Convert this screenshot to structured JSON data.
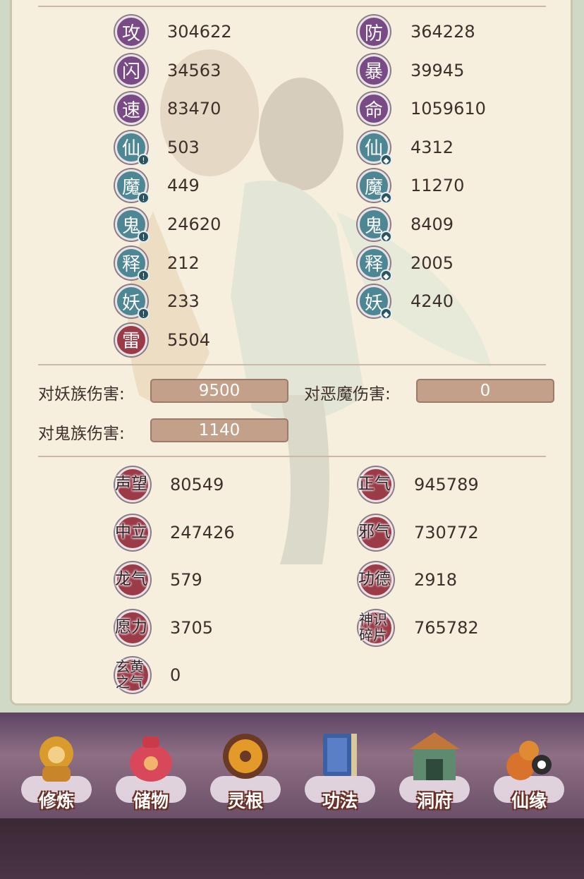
{
  "stats": [
    {
      "glyph": "攻",
      "value": "304622",
      "color": "purple",
      "marker": ""
    },
    {
      "glyph": "防",
      "value": "364228",
      "color": "purple",
      "marker": ""
    },
    {
      "glyph": "闪",
      "value": "34563",
      "color": "purple",
      "marker": ""
    },
    {
      "glyph": "暴",
      "value": "39945",
      "color": "purple",
      "marker": ""
    },
    {
      "glyph": "速",
      "value": "83470",
      "color": "purple",
      "marker": ""
    },
    {
      "glyph": "命",
      "value": "1059610",
      "color": "purple",
      "marker": ""
    },
    {
      "glyph": "仙",
      "value": "503",
      "color": "teal",
      "marker": "sword"
    },
    {
      "glyph": "仙",
      "value": "4312",
      "color": "teal",
      "marker": "shield"
    },
    {
      "glyph": "魔",
      "value": "449",
      "color": "teal",
      "marker": "sword"
    },
    {
      "glyph": "魔",
      "value": "11270",
      "color": "teal",
      "marker": "shield"
    },
    {
      "glyph": "鬼",
      "value": "24620",
      "color": "teal",
      "marker": "sword"
    },
    {
      "glyph": "鬼",
      "value": "8409",
      "color": "teal",
      "marker": "shield"
    },
    {
      "glyph": "释",
      "value": "212",
      "color": "teal",
      "marker": "sword"
    },
    {
      "glyph": "释",
      "value": "2005",
      "color": "teal",
      "marker": "shield"
    },
    {
      "glyph": "妖",
      "value": "233",
      "color": "teal",
      "marker": "sword"
    },
    {
      "glyph": "妖",
      "value": "4240",
      "color": "teal",
      "marker": "shield"
    },
    {
      "glyph": "雷",
      "value": "5504",
      "color": "red",
      "marker": ""
    }
  ],
  "damage": [
    {
      "label": "对妖族伤害:",
      "value": "9500"
    },
    {
      "label": "对恶魔伤害:",
      "value": "0"
    },
    {
      "label": "对鬼族伤害:",
      "value": "1140"
    }
  ],
  "reputation": [
    {
      "label": "声望",
      "value": "80549"
    },
    {
      "label": "正气",
      "value": "945789"
    },
    {
      "label": "中立",
      "value": "247426"
    },
    {
      "label": "邪气",
      "value": "730772"
    },
    {
      "label": "龙气",
      "value": "579"
    },
    {
      "label": "功德",
      "value": "2918"
    },
    {
      "label": "愿力",
      "value": "3705"
    },
    {
      "label": "神识碎片",
      "value": "765782"
    },
    {
      "label": "玄黄之气",
      "value": "0"
    }
  ],
  "nav": [
    {
      "label": "修炼",
      "icon": "monk-icon"
    },
    {
      "label": "储物",
      "icon": "pouch-icon"
    },
    {
      "label": "灵根",
      "icon": "spirit-root-icon"
    },
    {
      "label": "功法",
      "icon": "book-icon"
    },
    {
      "label": "洞府",
      "icon": "cave-palace-icon"
    },
    {
      "label": "仙缘",
      "icon": "gourd-icon"
    }
  ],
  "colors": {
    "purple": "#7a4a86",
    "teal": "#4e8794",
    "red": "#9c3b48"
  }
}
